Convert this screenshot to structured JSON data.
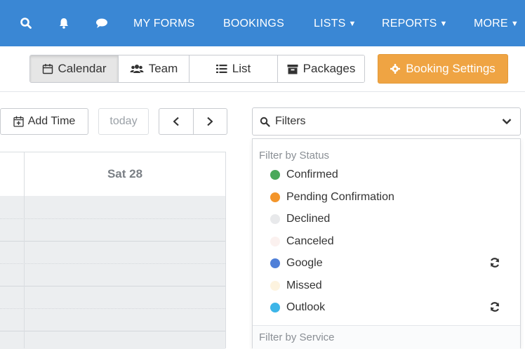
{
  "nav": {
    "my_forms": "MY FORMS",
    "bookings": "BOOKINGS",
    "lists": "LISTS",
    "reports": "REPORTS",
    "more": "MORE",
    "bg_color": "#3a87d4"
  },
  "views": {
    "calendar": "Calendar",
    "team": "Team",
    "list": "List",
    "packages": "Packages"
  },
  "settings_button": "Booking Settings",
  "controls": {
    "add_time": "Add Time",
    "today": "today",
    "prev": "<",
    "next": ">"
  },
  "calendar": {
    "day_header": "Sat 28"
  },
  "filters": {
    "label": "Filters",
    "status_heading": "Filter by Status",
    "statuses": [
      {
        "label": "Confirmed",
        "color": "#4aa85a"
      },
      {
        "label": "Pending Confirmation",
        "color": "#f3952b"
      },
      {
        "label": "Declined",
        "color": "#e8e9eb"
      },
      {
        "label": "Canceled",
        "color": "#fbf1ef"
      },
      {
        "label": "Google",
        "color": "#4f7fd8"
      },
      {
        "label": "Missed",
        "color": "#fdf3df"
      },
      {
        "label": "Outlook",
        "color": "#3db5e8"
      }
    ],
    "service_heading": "Filter by Service"
  },
  "colors": {
    "settings_orange": "#efa443",
    "slot_bg": "#eceef0"
  }
}
